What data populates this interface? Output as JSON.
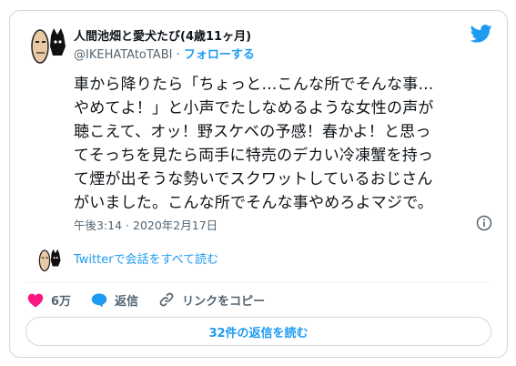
{
  "user": {
    "display_name": "人間池畑と愛犬たび(4歳11ヶ月)",
    "handle": "@IKEHATAtoTABI",
    "separator": "·",
    "follow_label": "フォローする"
  },
  "tweet": {
    "lines": [
      "車から降りたら「ちょっと…こんな所でそんな事…",
      "やめてよ！」と小声でたしなめるような女性の声が",
      "聴こえて、オッ！野スケベの予感！春かよ！と思っ",
      "てそっちを見たら両手に特売のデカい冷凍蟹を持っ",
      "て煙が出そうな勢いでスクワットしているおじさん",
      "がいました。こんな所でそんな事やめろよマジで。"
    ],
    "timestamp": "午後3:14 · 2020年2月17日"
  },
  "thread": {
    "link_label": "Twitterで会話をすべて読む"
  },
  "actions": {
    "like_count": "6万",
    "reply_label": "返信",
    "copy_link_label": "リンクをコピー"
  },
  "replies_button_label": "32件の返信を読む",
  "colors": {
    "accent": "#1d9bf0",
    "like": "#f91880",
    "text": "#0f1419",
    "muted": "#536471"
  },
  "icons": [
    "avatar-pig-dog",
    "twitter-bird-icon",
    "info-icon",
    "heart-icon",
    "reply-bubble-icon",
    "link-icon"
  ]
}
